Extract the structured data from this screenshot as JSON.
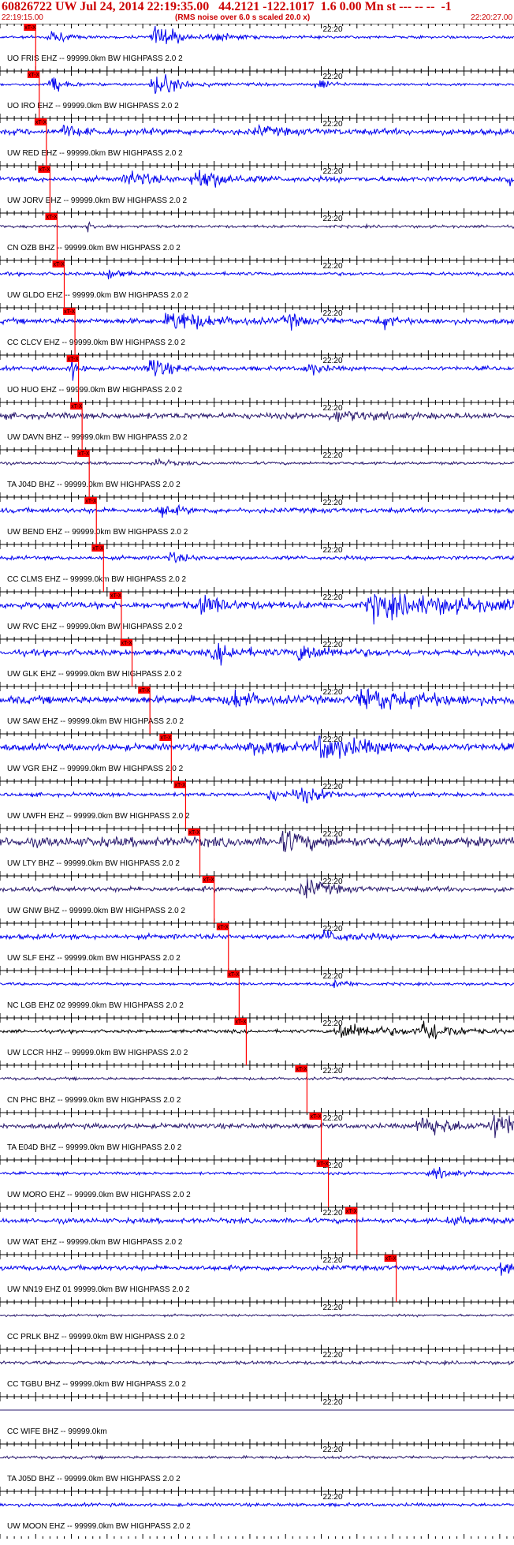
{
  "header": {
    "title": "60826722 UW Jul 24, 2014 22:19:35.00   44.2121 -122.1017  1.6 0.00 Mn st --- -- --  -1",
    "start_time": "22:19:15.00",
    "note": "(RMS noise over 6.0 s scaled 20.0 x)",
    "end_time": "22:20:27.00"
  },
  "chart_data": {
    "type": "line",
    "title": "60826722 UW Jul 24, 2014 22:19:35.00   44.2121 -122.1017  1.6 0.00 Mn st --- -- --  -1",
    "x_range": [
      "22:19:15.00",
      "22:20:27.00"
    ],
    "time_label": "22:20",
    "pick_label": "xT-X",
    "colors": {
      "trace_blue": "#0000ee",
      "trace_purple": "#2a1a6e",
      "trace_black": "#000000",
      "pick": "#ff0000",
      "axis": "#000000",
      "header": "#cc0000"
    },
    "traces": [
      {
        "label": "UO FRIS EHZ -- 99999.0km BW  HIGHPASS  2.0  2",
        "color": "blue",
        "pick_time": "22:19:20",
        "amp": 0.1,
        "events": [
          [
            10,
            0.6,
            2
          ],
          [
            30,
            1.0,
            4
          ],
          [
            42,
            0.3,
            3
          ]
        ]
      },
      {
        "label": "UO IRO EHZ -- 99999.0km BW  HIGHPASS  2.0  2",
        "color": "blue",
        "pick_time": "22:19:20.5",
        "amp": 0.1,
        "events": [
          [
            10,
            0.7,
            2
          ],
          [
            30,
            1.0,
            4
          ],
          [
            62,
            0.5,
            2
          ]
        ]
      },
      {
        "label": "UW RED EHZ -- 99999.0km BW  HIGHPASS  2.0  2",
        "color": "blue",
        "pick_time": "22:19:21.5",
        "amp": 0.22,
        "events": [
          [
            12,
            0.4,
            3
          ],
          [
            50,
            0.3,
            4
          ]
        ]
      },
      {
        "label": "UW JORV EHZ -- 99999.0km BW  HIGHPASS  2.0  2",
        "color": "blue",
        "pick_time": "22:19:22",
        "amp": 0.18,
        "events": [
          [
            25,
            0.6,
            4
          ],
          [
            38,
            0.9,
            5
          ],
          [
            98,
            0.5,
            3
          ]
        ]
      },
      {
        "label": "CN OZB BHZ -- 99999.0km BW  HIGHPASS  2.0  2",
        "color": "purple",
        "pick_time": "22:19:23",
        "amp": 0.1,
        "events": [
          [
            17,
            0.3,
            2
          ]
        ]
      },
      {
        "label": "UW GLDO EHZ -- 99999.0km BW  HIGHPASS  2.0  2",
        "color": "blue",
        "pick_time": "22:19:24",
        "amp": 0.12,
        "events": [
          [
            21,
            0.5,
            2
          ]
        ]
      },
      {
        "label": "CC CLCV EHZ -- 99999.0km BW  HIGHPASS  2.0  2",
        "color": "blue",
        "pick_time": "22:19:25.5",
        "amp": 0.2,
        "events": [
          [
            33,
            0.9,
            6
          ],
          [
            56,
            0.5,
            3
          ],
          [
            74,
            0.6,
            2
          ]
        ]
      },
      {
        "label": "UO HUO EHZ -- 99999.0km BW  HIGHPASS  2.0  2",
        "color": "blue",
        "pick_time": "22:19:26",
        "amp": 0.15,
        "events": [
          [
            14,
            0.8,
            1
          ],
          [
            29,
            1.0,
            3
          ],
          [
            60,
            0.6,
            2
          ]
        ]
      },
      {
        "label": "UW DAVN BHZ -- 99999.0km BW  HIGHPASS  2.0  2",
        "color": "purple",
        "pick_time": "22:19:26.5",
        "amp": 0.22,
        "events": [
          [
            65,
            0.4,
            5
          ]
        ]
      },
      {
        "label": "TA J04D BHZ -- 99999.0km BW  HIGHPASS  2.0  2",
        "color": "purple",
        "pick_time": "22:19:27.5",
        "amp": 0.1,
        "events": [
          [
            30,
            0.3,
            3
          ]
        ]
      },
      {
        "label": "UW BEND EHZ -- 99999.0km BW  HIGHPASS  2.0  2",
        "color": "blue",
        "pick_time": "22:19:28.5",
        "amp": 0.18,
        "events": [
          [
            31,
            0.5,
            3
          ]
        ]
      },
      {
        "label": "CC CLMS EHZ -- 99999.0km BW  HIGHPASS  2.0  2",
        "color": "blue",
        "pick_time": "22:19:29.5",
        "amp": 0.14,
        "events": [
          [
            33,
            0.4,
            3
          ]
        ]
      },
      {
        "label": "UW RVC EHZ -- 99999.0km BW  HIGHPASS  2.0  2",
        "color": "blue",
        "pick_time": "22:19:32",
        "amp": 0.25,
        "events": [
          [
            39,
            0.8,
            4
          ],
          [
            72,
            1.0,
            16
          ]
        ]
      },
      {
        "label": "UW GLK EHZ -- 99999.0km BW  HIGHPASS  2.0  2",
        "color": "blue",
        "pick_time": "22:19:33.5",
        "amp": 0.22,
        "events": [
          [
            42,
            0.7,
            4
          ],
          [
            58,
            0.6,
            6
          ]
        ]
      },
      {
        "label": "UW SAW EHZ -- 99999.0km BW  HIGHPASS  2.0  2",
        "color": "blue",
        "pick_time": "22:19:36",
        "amp": 0.28,
        "events": [
          [
            45,
            0.7,
            4
          ],
          [
            70,
            0.9,
            10
          ]
        ]
      },
      {
        "label": "UW VGR EHZ -- 99999.0km BW  HIGHPASS  2.0  2",
        "color": "blue",
        "pick_time": "22:19:39",
        "amp": 0.25,
        "events": [
          [
            49,
            0.6,
            4
          ],
          [
            62,
            1.0,
            8
          ]
        ]
      },
      {
        "label": "UW UWFH EHZ -- 99999.0km BW  HIGHPASS  2.0  2",
        "color": "blue",
        "pick_time": "22:19:41",
        "amp": 0.14,
        "events": [
          [
            52,
            0.5,
            3
          ],
          [
            58,
            0.6,
            5
          ]
        ]
      },
      {
        "label": "UW LTY BHZ -- 99999.0km BW  HIGHPASS  2.0  2",
        "color": "purple",
        "pick_time": "22:19:43",
        "amp": 0.35,
        "events": [
          [
            55,
            0.9,
            4
          ]
        ]
      },
      {
        "label": "UW GNW BHZ -- 99999.0km BW  HIGHPASS  2.0  2",
        "color": "purple",
        "pick_time": "22:19:45",
        "amp": 0.18,
        "events": [
          [
            59,
            0.8,
            4
          ]
        ]
      },
      {
        "label": "UW SLF EHZ -- 99999.0km BW  HIGHPASS  2.0  2",
        "color": "blue",
        "pick_time": "22:19:47",
        "amp": 0.18,
        "events": [
          [
            63,
            0.4,
            5
          ]
        ]
      },
      {
        "label": "NC LGB EHZ 02 99999.0km BW  HIGHPASS  2.0  2",
        "color": "blue",
        "pick_time": "22:19:48.5",
        "amp": 0.1,
        "events": [
          [
            65,
            0.3,
            3
          ]
        ]
      },
      {
        "label": "UW LCCR HHZ -- 99999.0km BW  HIGHPASS  2.0  2",
        "color": "black",
        "pick_time": "22:19:49.5",
        "amp": 0.12,
        "events": [
          [
            66,
            0.7,
            8
          ],
          [
            82,
            0.9,
            5
          ]
        ]
      },
      {
        "label": "CN PHC BHZ -- 99999.0km BW  HIGHPASS  2.0  2",
        "color": "purple",
        "pick_time": "22:19:58",
        "amp": 0.1,
        "events": []
      },
      {
        "label": "TA E04D BHZ -- 99999.0km BW  HIGHPASS  2.0  2",
        "color": "purple",
        "pick_time": "22:20:00",
        "amp": 0.18,
        "events": [
          [
            82,
            0.9,
            5
          ],
          [
            96,
            1.0,
            6
          ]
        ]
      },
      {
        "label": "UW MORO EHZ -- 99999.0km BW  HIGHPASS  2.0  2",
        "color": "blue",
        "pick_time": "22:20:01",
        "amp": 0.1,
        "events": [
          [
            84,
            0.4,
            4
          ]
        ]
      },
      {
        "label": "UW WAT EHZ -- 99999.0km BW  HIGHPASS  2.0  2",
        "color": "blue",
        "pick_time": "22:20:05",
        "amp": 0.18,
        "events": [
          [
            88,
            0.3,
            4
          ]
        ]
      },
      {
        "label": "UW NN19 EHZ 01 99999.0km BW  HIGHPASS  2.0  2",
        "color": "blue",
        "pick_time": "22:20:10.5",
        "amp": 0.18,
        "events": [
          [
            97,
            0.8,
            4
          ]
        ]
      },
      {
        "label": "CC PRLK BHZ -- 99999.0km BW  HIGHPASS  2.0  2",
        "color": "purple",
        "pick_time": "",
        "amp": 0.08,
        "events": []
      },
      {
        "label": "CC TGBU BHZ -- 99999.0km BW  HIGHPASS  2.0  2",
        "color": "purple",
        "pick_time": "",
        "amp": 0.12,
        "events": []
      },
      {
        "label": "CC WIFE BHZ -- 99999.0km",
        "color": "purple",
        "pick_time": "",
        "amp": 0.0,
        "events": []
      },
      {
        "label": "TA J05D BHZ -- 99999.0km BW  HIGHPASS  2.0  2",
        "color": "purple",
        "pick_time": "",
        "amp": 0.1,
        "events": []
      },
      {
        "label": "UW MOON EHZ -- 99999.0km BW  HIGHPASS  2.0  2",
        "color": "blue",
        "pick_time": "",
        "amp": 0.12,
        "events": []
      }
    ]
  }
}
